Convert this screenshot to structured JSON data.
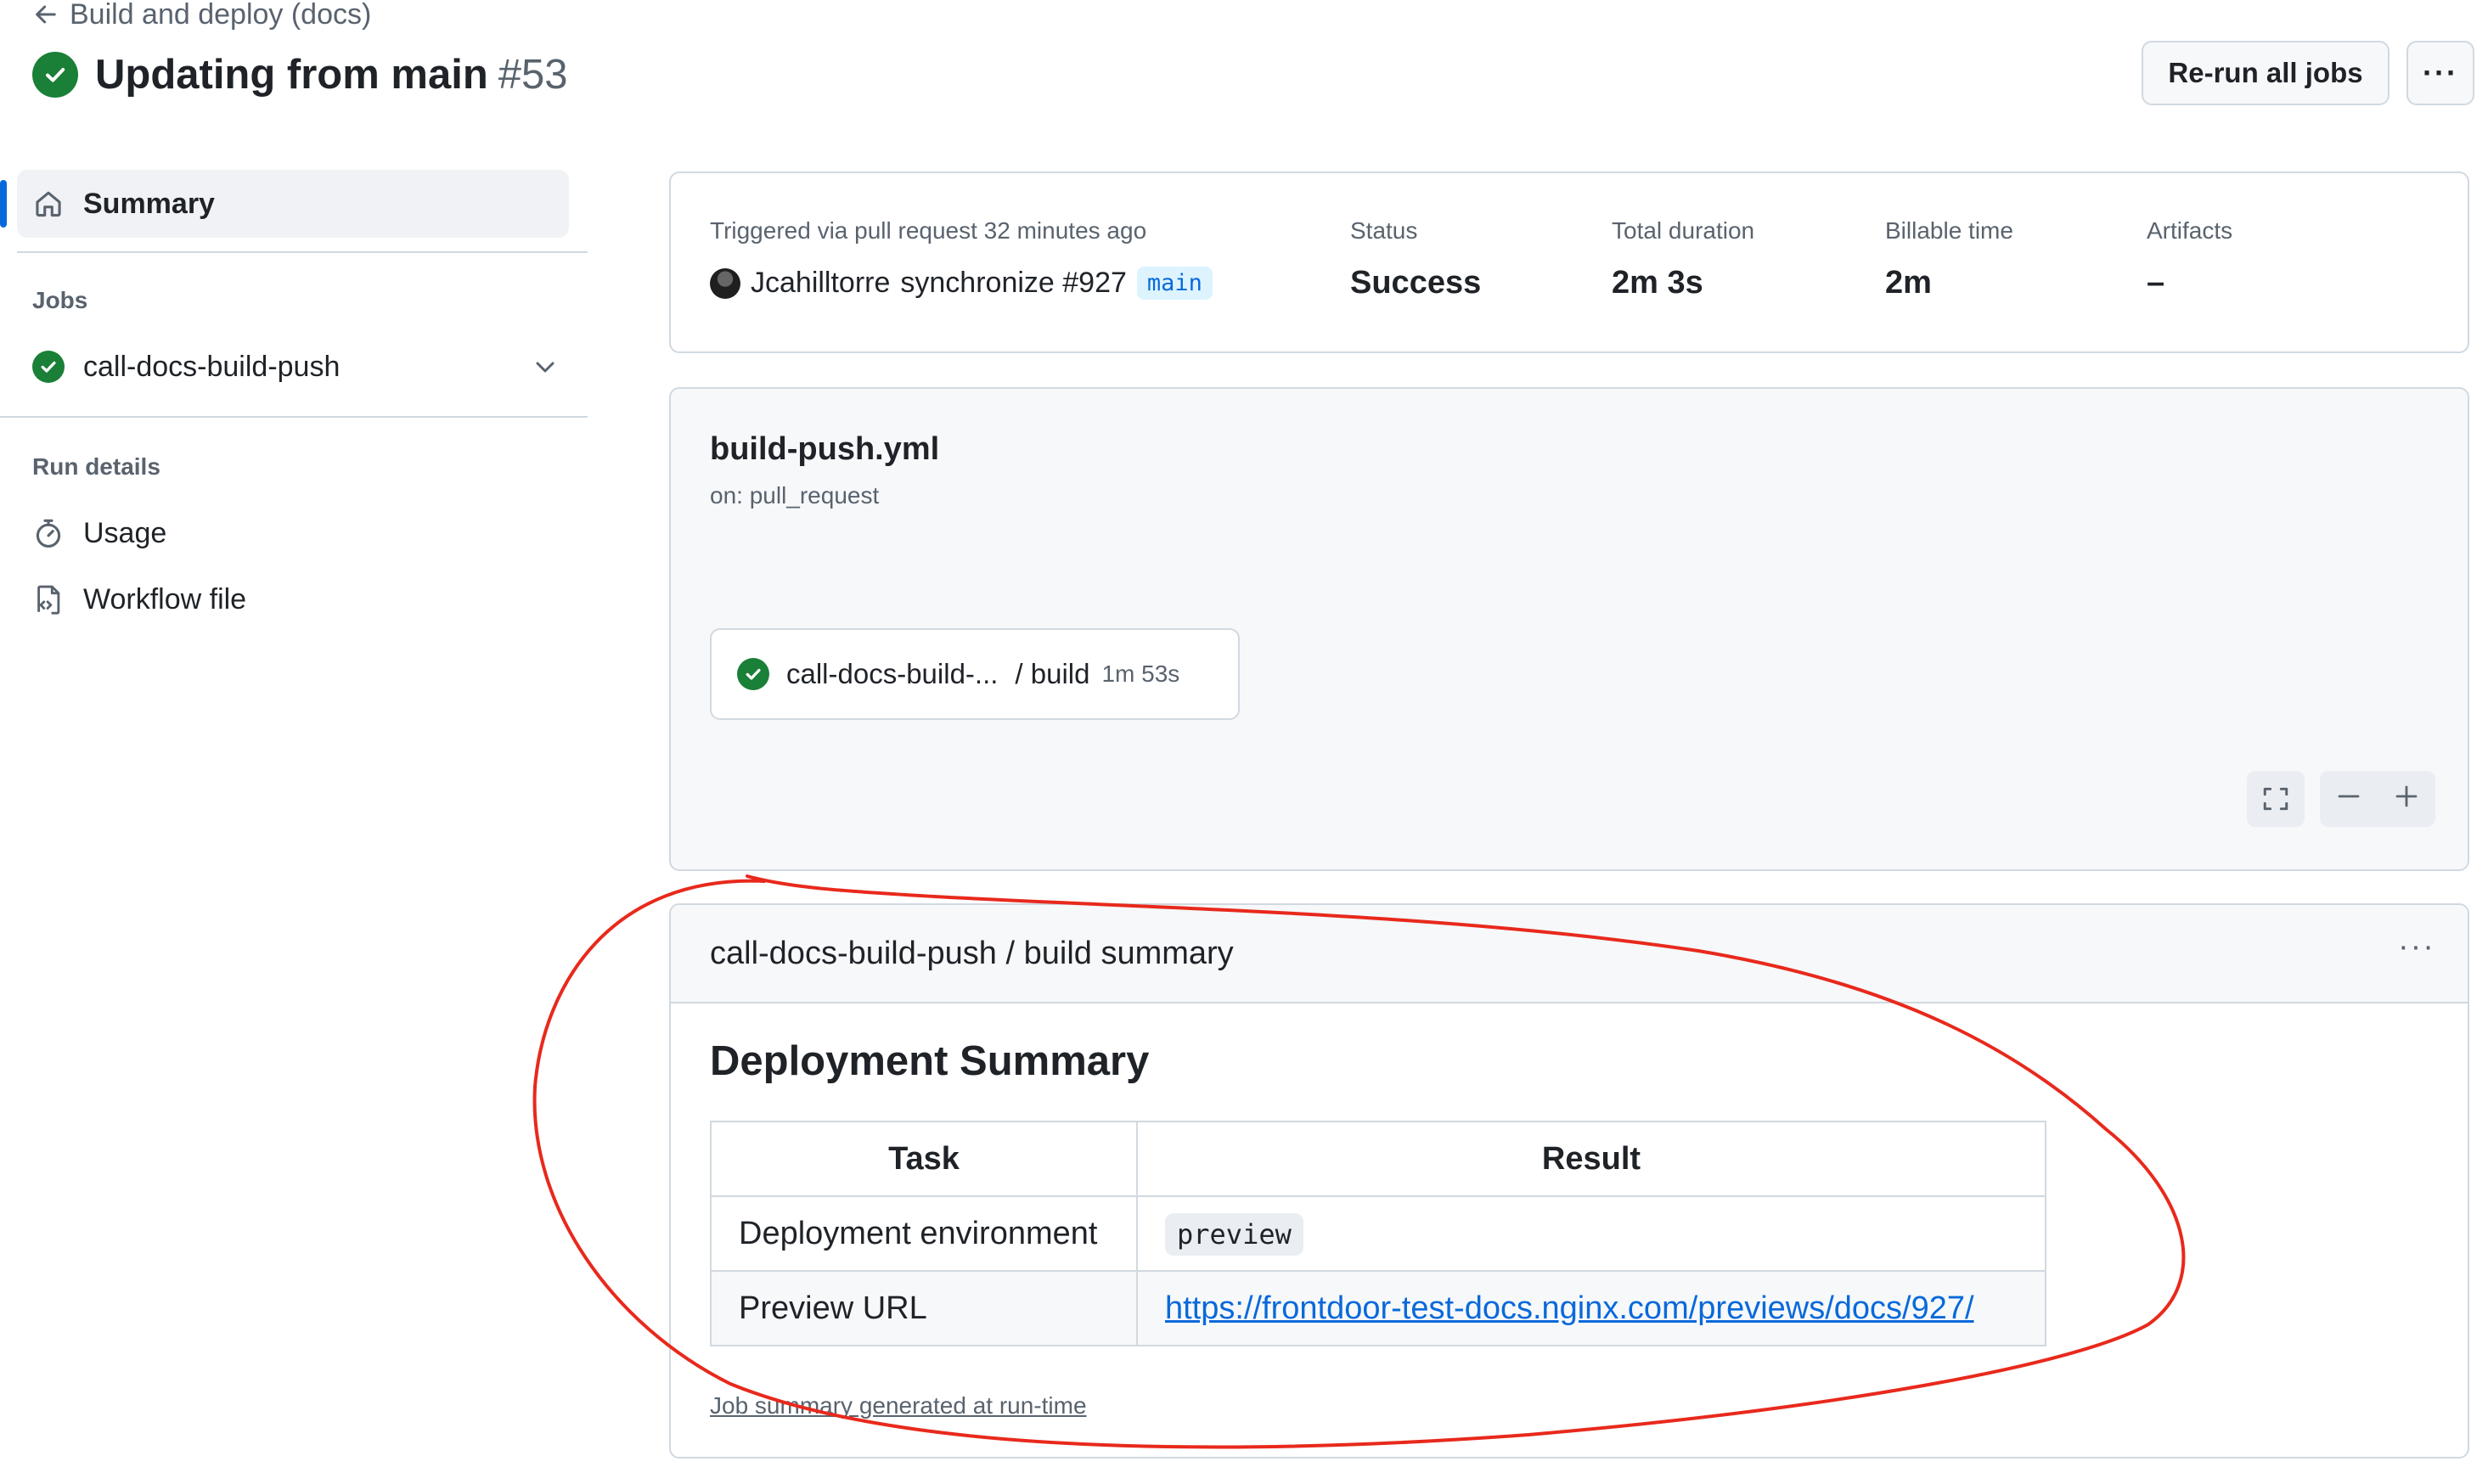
{
  "header": {
    "back_label": "Build and deploy (docs)",
    "title": "Updating from main",
    "run_number": "#53",
    "rerun_label": "Re-run all jobs",
    "more_label": "···"
  },
  "sidebar": {
    "summary_label": "Summary",
    "jobs_heading": "Jobs",
    "job_label": "call-docs-build-push",
    "run_details_heading": "Run details",
    "usage_label": "Usage",
    "workflow_file_label": "Workflow file"
  },
  "run_info": {
    "triggered_text": "Triggered via pull request 32 minutes ago",
    "actor": "Jcahilltorre",
    "event_text": "synchronize #927",
    "branch": "main",
    "status_label": "Status",
    "status_value": "Success",
    "duration_label": "Total duration",
    "duration_value": "2m 3s",
    "billable_label": "Billable time",
    "billable_value": "2m",
    "artifacts_label": "Artifacts",
    "artifacts_value": "–"
  },
  "workflow": {
    "file_name": "build-push.yml",
    "trigger": "on: pull_request",
    "job_name": "call-docs-build-...",
    "job_step": "/ build",
    "job_duration": "1m 53s"
  },
  "summary": {
    "header": "call-docs-build-push / build summary",
    "more_label": "···",
    "heading": "Deployment Summary",
    "columns": [
      "Task",
      "Result"
    ],
    "rows": [
      {
        "task": "Deployment environment",
        "result": "preview"
      },
      {
        "task": "Preview URL",
        "result": "https://frontdoor-test-docs.nginx.com/previews/docs/927/"
      }
    ],
    "footer": "Job summary generated at run-time"
  },
  "colors": {
    "success": "#1a7f37",
    "accent": "#0969da",
    "annotation": "#e8291c"
  }
}
